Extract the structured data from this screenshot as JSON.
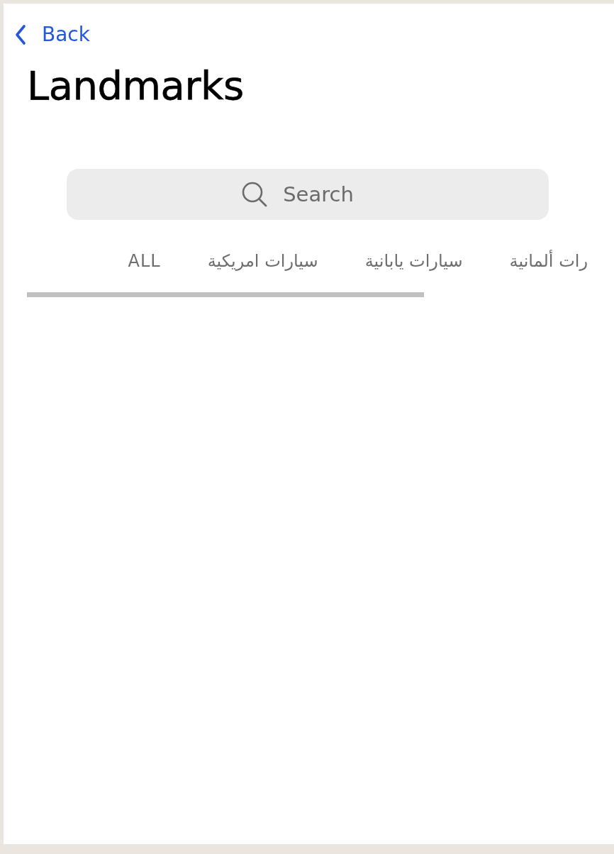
{
  "nav": {
    "back": "Back"
  },
  "title": "Landmarks",
  "search": {
    "placeholder": "Search"
  },
  "tabs": [
    {
      "label": "رات ألمانية",
      "selected": false
    },
    {
      "label": "سيارات يابانية",
      "selected": false
    },
    {
      "label": "سيارات امريكية",
      "selected": false
    },
    {
      "label": "ALL",
      "selected": false
    }
  ]
}
